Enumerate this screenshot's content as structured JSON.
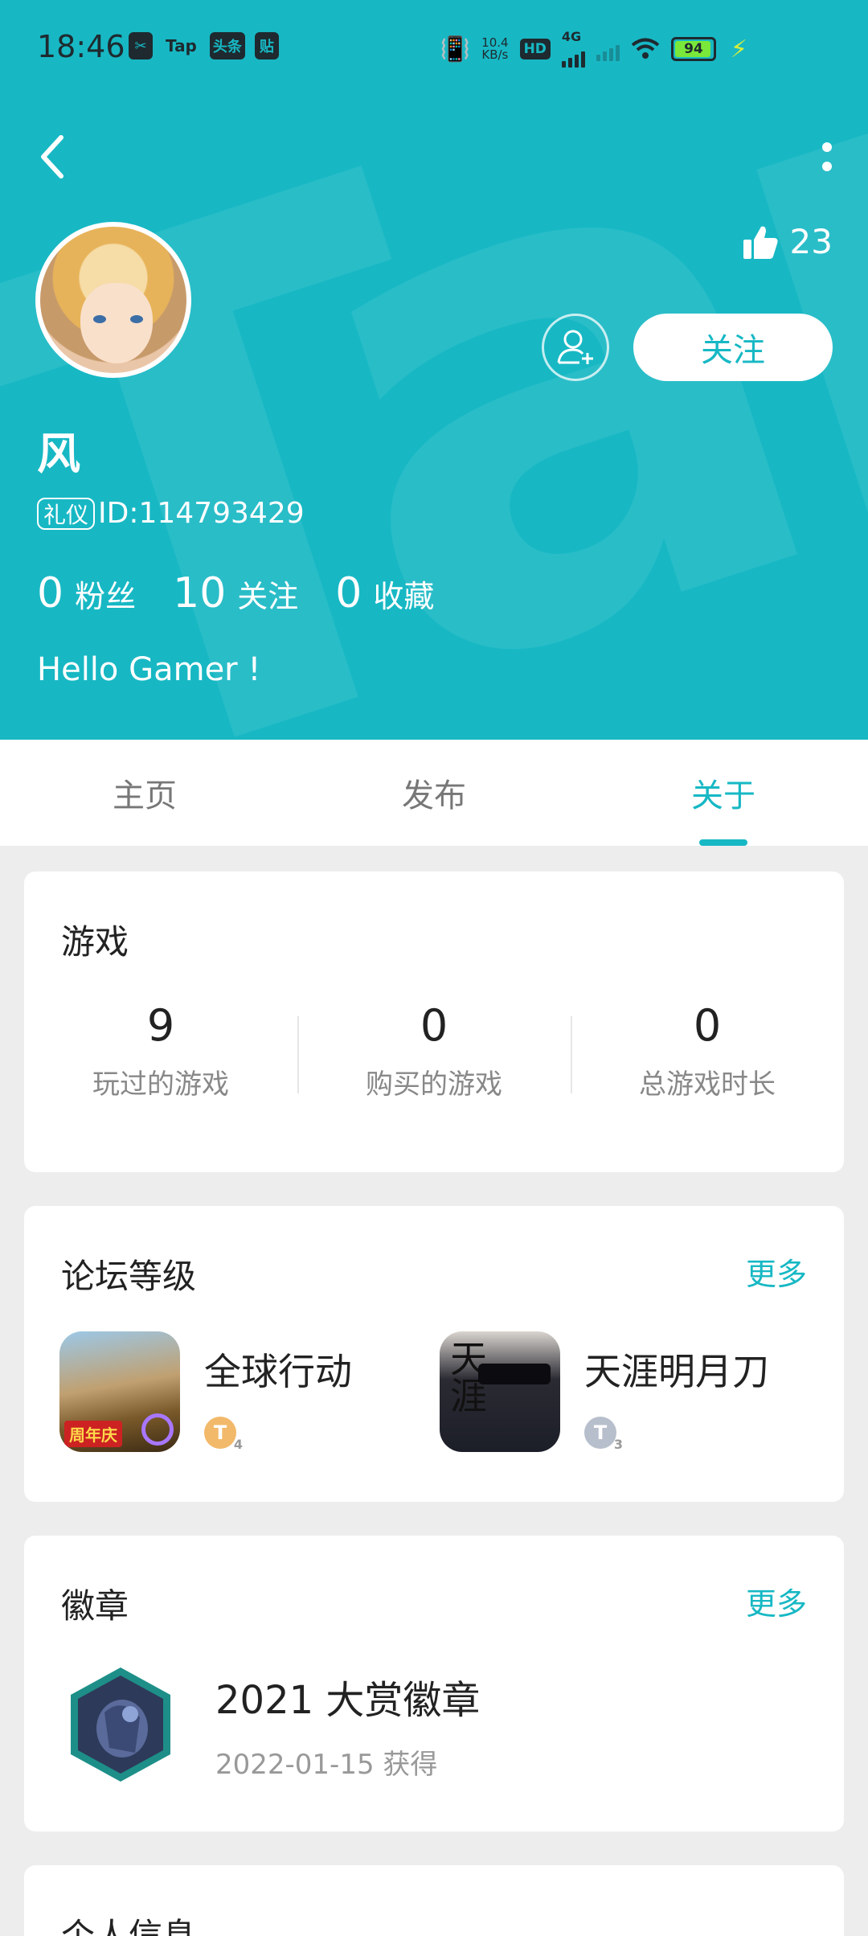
{
  "status_bar": {
    "time": "18:46",
    "app_icons": [
      "Tap",
      "头条",
      "贴"
    ],
    "net_speed": "10.4",
    "net_unit": "KB/s",
    "hd": "HD",
    "network_type": "4G",
    "battery": "94"
  },
  "header": {
    "likes": "23",
    "follow_label": "关注",
    "username": "风",
    "id_badge": "礼仪",
    "id_text": "ID:114793429",
    "stats": [
      {
        "num": "0",
        "label": "粉丝"
      },
      {
        "num": "10",
        "label": "关注"
      },
      {
        "num": "0",
        "label": "收藏"
      }
    ],
    "bio": "Hello Gamer !"
  },
  "tabs": [
    {
      "label": "主页",
      "active": false
    },
    {
      "label": "发布",
      "active": false
    },
    {
      "label": "关于",
      "active": true
    }
  ],
  "games_card": {
    "title": "游戏",
    "stats": [
      {
        "num": "9",
        "label": "玩过的游戏"
      },
      {
        "num": "0",
        "label": "购买的游戏"
      },
      {
        "num": "0",
        "label": "总游戏时长"
      }
    ]
  },
  "forum_card": {
    "title": "论坛等级",
    "more": "更多",
    "items": [
      {
        "name": "全球行动",
        "icon_tag": "周年庆",
        "level_letter": "T",
        "level_num": "4"
      },
      {
        "name": "天涯明月刀",
        "icon_calli": "天涯",
        "level_letter": "T",
        "level_num": "3"
      }
    ]
  },
  "badges_card": {
    "title": "徽章",
    "more": "更多",
    "badge_name": "2021 大赏徽章",
    "badge_date": "2022-01-15 获得"
  },
  "info_card": {
    "title": "个人信息"
  },
  "colors": {
    "accent": "#17b8c4"
  }
}
